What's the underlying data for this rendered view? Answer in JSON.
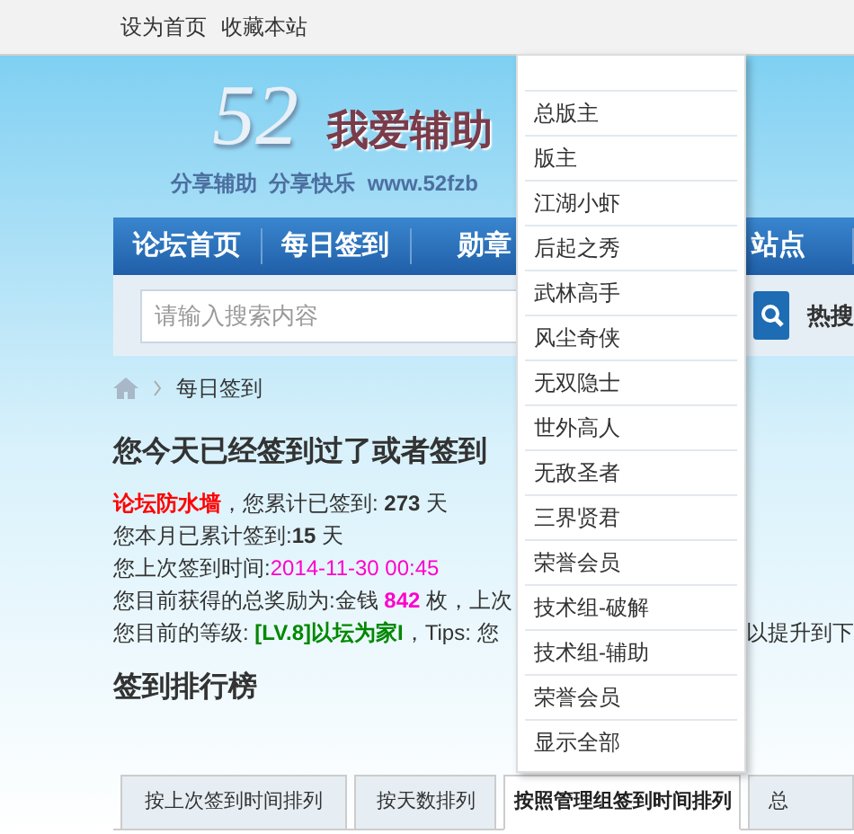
{
  "top_links": [
    "设为首页",
    "收藏本站"
  ],
  "logo": {
    "number": "52",
    "title": "我爱辅助",
    "slogan": "分享辅助  分享快乐  www.52fzb"
  },
  "nav": [
    {
      "label": "论坛首页"
    },
    {
      "label": "每日签到"
    },
    {
      "label": "勋章"
    },
    {
      "label": "站点"
    }
  ],
  "search": {
    "placeholder": "请输入搜索内容",
    "hot_label": "热搜"
  },
  "breadcrumb": {
    "current": "每日签到"
  },
  "status_heading": "您今天已经签到过了或者签到",
  "stats": [
    {
      "parts": [
        {
          "kind": "name",
          "text": "论坛防水墙"
        },
        {
          "kind": "plain",
          "text": "，您累计已签到: "
        },
        {
          "kind": "strong",
          "text": "273"
        },
        {
          "kind": "plain",
          "text": " 天"
        }
      ]
    },
    {
      "parts": [
        {
          "kind": "plain",
          "text": "您本月已累计签到:"
        },
        {
          "kind": "strong",
          "text": "15"
        },
        {
          "kind": "plain",
          "text": " 天"
        }
      ]
    },
    {
      "parts": [
        {
          "kind": "plain",
          "text": "您上次签到时间:"
        },
        {
          "kind": "date",
          "text": "2014-11-30 00:45"
        }
      ]
    },
    {
      "parts": [
        {
          "kind": "plain",
          "text": "您目前获得的总奖励为:金钱 "
        },
        {
          "kind": "number",
          "text": "842"
        },
        {
          "kind": "plain",
          "text": " 枚，上次"
        }
      ]
    },
    {
      "parts": [
        {
          "kind": "plain",
          "text": "您目前的等级: "
        },
        {
          "kind": "level",
          "text": "[LV.8]以坛为家I"
        },
        {
          "kind": "plain",
          "text": "，Tips: 您"
        }
      ],
      "tail": "以提升到下"
    }
  ],
  "ranking_title": "签到排行榜",
  "tabs": [
    {
      "label": "按上次签到时间排列",
      "selected": false
    },
    {
      "label": "按天数排列",
      "selected": false
    },
    {
      "label": "按照管理组签到时间排列",
      "selected": true
    },
    {
      "label": "总",
      "selected": false
    }
  ],
  "group_menu": [
    "总版主",
    "版主",
    "江湖小虾",
    "后起之秀",
    "武林高手",
    "风尘奇侠",
    "无双隐士",
    "世外高人",
    "无敌圣者",
    "三界贤君",
    "荣誉会员",
    "技术组-破解",
    "技术组-辅助",
    "荣誉会员",
    "显示全部"
  ]
}
